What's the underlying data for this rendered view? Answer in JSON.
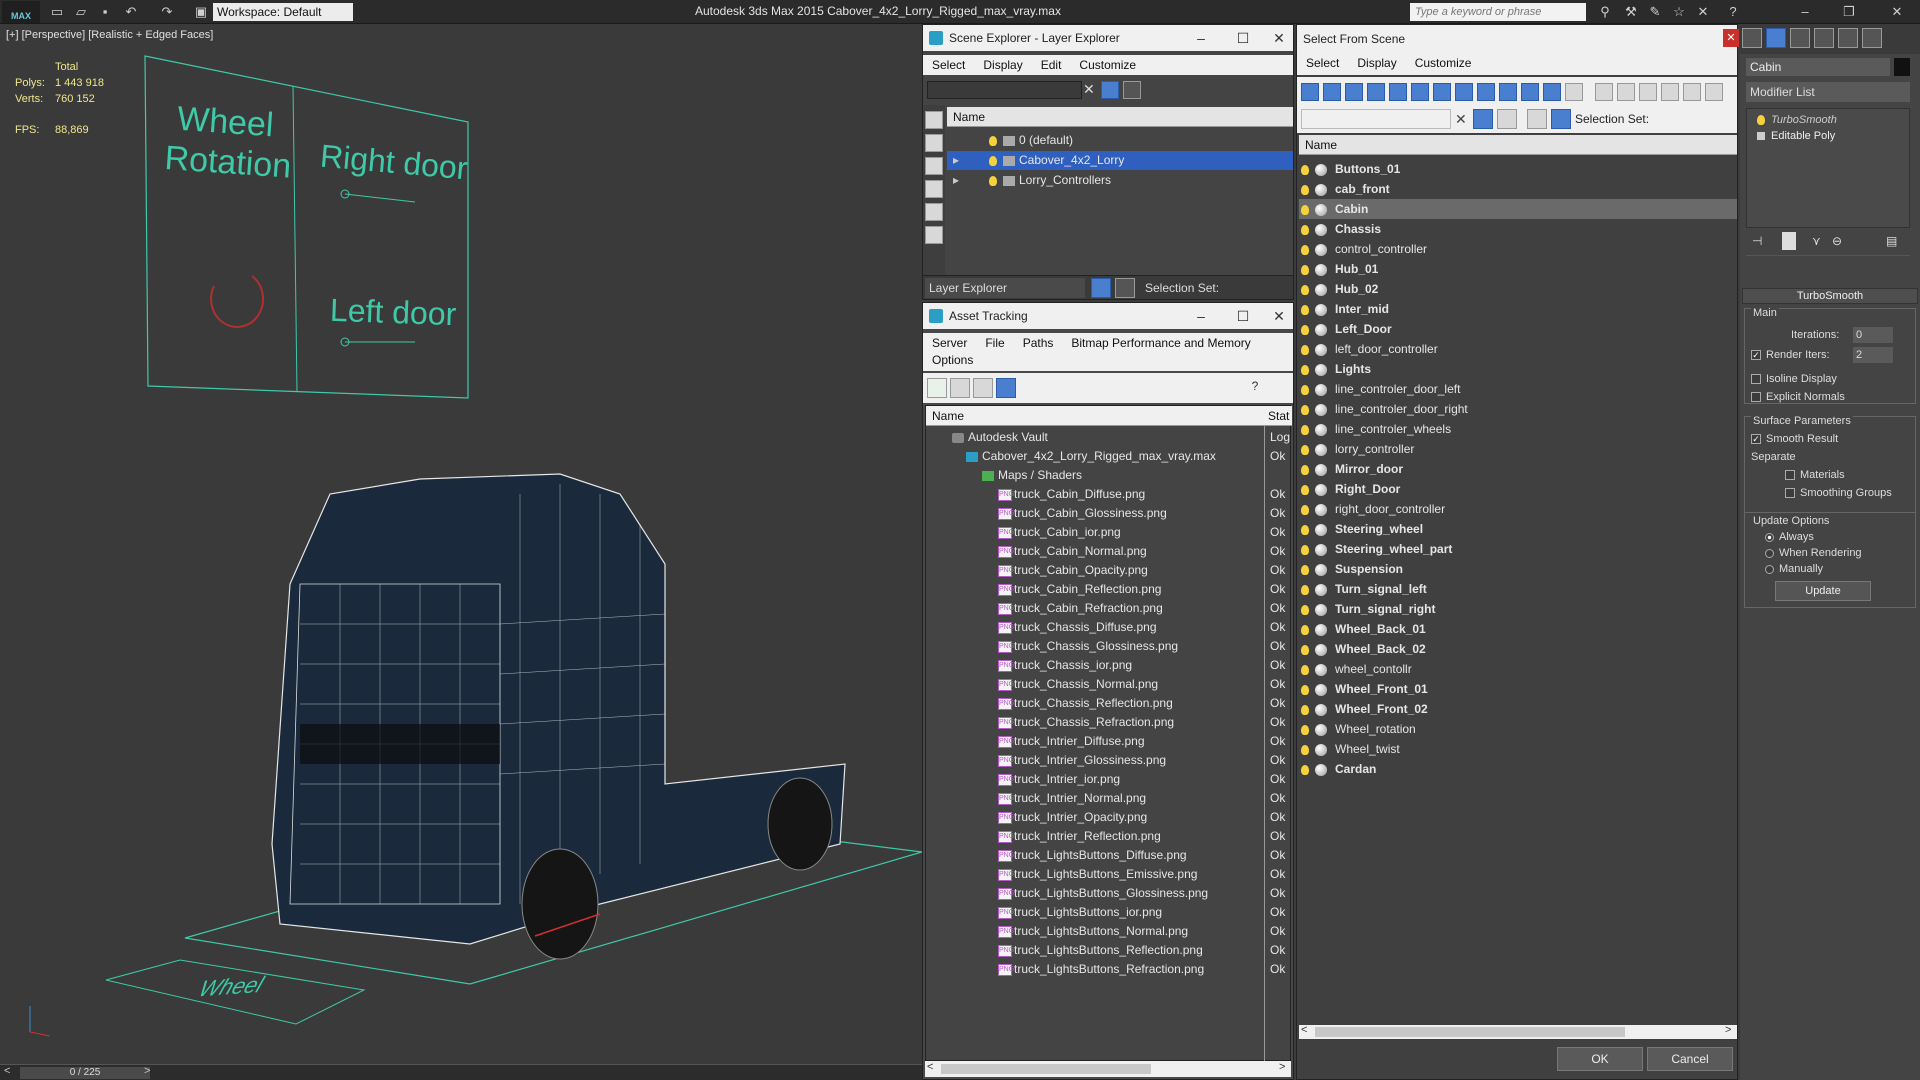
{
  "titlebar": {
    "workspace": "Workspace: Default",
    "app_title": "Autodesk 3ds Max  2015     Cabover_4x2_Lorry_Rigged_max_vray.max",
    "search_placeholder": "Type a keyword or phrase"
  },
  "viewport": {
    "label": "[+] [Perspective] [Realistic + Edged Faces]",
    "stats": {
      "total_label": "Total",
      "polys_label": "Polys:",
      "polys": "1 443 918",
      "verts_label": "Verts:",
      "verts": "760 152",
      "fps_label": "FPS:",
      "fps": "88,869"
    },
    "controls": {
      "wheel_rotation": "Wheel Rotation",
      "right_door": "Right door",
      "left_door": "Left door",
      "wheel_floor": "Wheel"
    },
    "timeline": "0 / 225"
  },
  "scene_explorer": {
    "title": "Scene Explorer - Layer Explorer",
    "menu": [
      "Select",
      "Display",
      "Edit",
      "Customize"
    ],
    "col_name": "Name",
    "layers": [
      {
        "name": "0 (default)",
        "selected": false
      },
      {
        "name": "Cabover_4x2_Lorry",
        "selected": true
      },
      {
        "name": "Lorry_Controllers",
        "selected": false
      }
    ],
    "footer_dropdown": "Layer Explorer",
    "footer_selset": "Selection Set:"
  },
  "asset_tracking": {
    "title": "Asset Tracking",
    "menu": [
      "Server",
      "File",
      "Paths",
      "Bitmap Performance and Memory"
    ],
    "menu2": [
      "Options"
    ],
    "col_name": "Name",
    "col_status": "Stat",
    "vault": "Autodesk Vault",
    "vault_status": "Log",
    "file": "Cabover_4x2_Lorry_Rigged_max_vray.max",
    "file_status": "Ok",
    "maps": "Maps / Shaders",
    "items": [
      "truck_Cabin_Diffuse.png",
      "truck_Cabin_Glossiness.png",
      "truck_Cabin_ior.png",
      "truck_Cabin_Normal.png",
      "truck_Cabin_Opacity.png",
      "truck_Cabin_Reflection.png",
      "truck_Cabin_Refraction.png",
      "truck_Chassis_Diffuse.png",
      "truck_Chassis_Glossiness.png",
      "truck_Chassis_ior.png",
      "truck_Chassis_Normal.png",
      "truck_Chassis_Reflection.png",
      "truck_Chassis_Refraction.png",
      "truck_Intrier_Diffuse.png",
      "truck_Intrier_Glossiness.png",
      "truck_Intrier_ior.png",
      "truck_Intrier_Normal.png",
      "truck_Intrier_Opacity.png",
      "truck_Intrier_Reflection.png",
      "truck_LightsButtons_Diffuse.png",
      "truck_LightsButtons_Emissive.png",
      "truck_LightsButtons_Glossiness.png",
      "truck_LightsButtons_ior.png",
      "truck_LightsButtons_Normal.png",
      "truck_LightsButtons_Reflection.png",
      "truck_LightsButtons_Refraction.png"
    ],
    "item_status": "Ok"
  },
  "select_from_scene": {
    "title": "Select From Scene",
    "menu": [
      "Select",
      "Display",
      "Customize"
    ],
    "selset": "Selection Set:",
    "col_name": "Name",
    "objects": [
      {
        "name": "Buttons_01",
        "bold": true
      },
      {
        "name": "cab_front",
        "bold": true
      },
      {
        "name": "Cabin",
        "bold": true,
        "highlight": true
      },
      {
        "name": "Chassis",
        "bold": true
      },
      {
        "name": "control_controller",
        "bold": false
      },
      {
        "name": "Hub_01",
        "bold": true
      },
      {
        "name": "Hub_02",
        "bold": true
      },
      {
        "name": "Inter_mid",
        "bold": true
      },
      {
        "name": "Left_Door",
        "bold": true
      },
      {
        "name": "left_door_controller",
        "bold": false
      },
      {
        "name": "Lights",
        "bold": true
      },
      {
        "name": "line_controler_door_left",
        "bold": false
      },
      {
        "name": "line_controler_door_right",
        "bold": false
      },
      {
        "name": "line_controler_wheels",
        "bold": false
      },
      {
        "name": "lorry_controller",
        "bold": false
      },
      {
        "name": "Mirror_door",
        "bold": true
      },
      {
        "name": "Right_Door",
        "bold": true
      },
      {
        "name": "right_door_controller",
        "bold": false
      },
      {
        "name": "Steering_wheel",
        "bold": true
      },
      {
        "name": "Steering_wheel_part",
        "bold": true
      },
      {
        "name": "Suspension",
        "bold": true
      },
      {
        "name": "Turn_signal_left",
        "bold": true
      },
      {
        "name": "Turn_signal_right",
        "bold": true
      },
      {
        "name": "Wheel_Back_01",
        "bold": true
      },
      {
        "name": "Wheel_Back_02",
        "bold": true
      },
      {
        "name": "wheel_contollr",
        "bold": false
      },
      {
        "name": "Wheel_Front_01",
        "bold": true
      },
      {
        "name": "Wheel_Front_02",
        "bold": true
      },
      {
        "name": "Wheel_rotation",
        "bold": false
      },
      {
        "name": "Wheel_twist",
        "bold": false
      },
      {
        "name": "Cardan",
        "bold": true
      }
    ],
    "ok": "OK",
    "cancel": "Cancel"
  },
  "modify_panel": {
    "object_name": "Cabin",
    "modifier_list": "Modifier List",
    "stack": [
      {
        "name": "TurboSmooth",
        "italic": true
      },
      {
        "name": "Editable Poly",
        "italic": false
      }
    ],
    "rollout_title": "TurboSmooth",
    "main_label": "Main",
    "iterations_label": "Iterations:",
    "iterations": "0",
    "render_iters_label": "Render Iters:",
    "render_iters": "2",
    "isoline": "Isoline Display",
    "explicit_normals": "Explicit Normals",
    "surface_params": "Surface Parameters",
    "smooth_result": "Smooth Result",
    "separate": "Separate",
    "materials": "Materials",
    "smoothing_groups": "Smoothing Groups",
    "update_options": "Update Options",
    "always": "Always",
    "when_rendering": "When Rendering",
    "manually": "Manually",
    "update_button": "Update"
  },
  "colors": {
    "selection": "#2f5fbf",
    "controller_text": "#3fc9a8",
    "stat_text": "#f0e68c"
  }
}
